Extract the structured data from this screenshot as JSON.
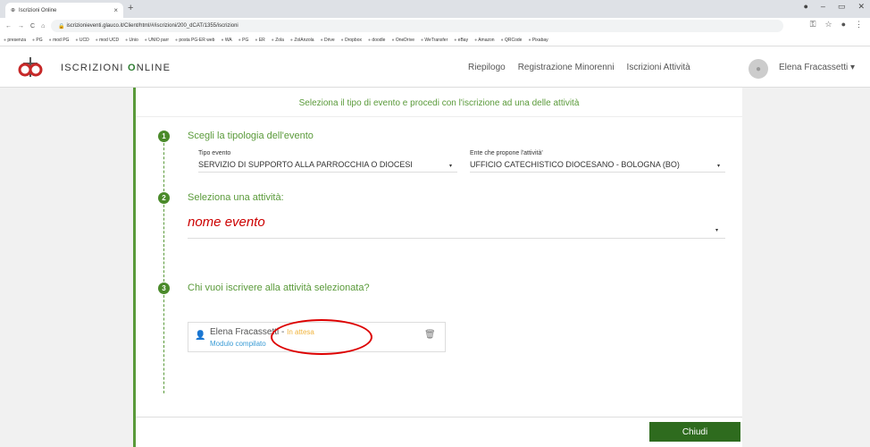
{
  "browser": {
    "tab_title": "Iscrizioni Online",
    "url": "iscrizionieventi.glauco.it/Client/html/#/iscrizioni/200_dCAT/1355/iscrizioni",
    "bookmarks": [
      "presenza",
      "PG",
      "mod PG",
      "UCD",
      "mod UCD",
      "Unio",
      "UNIO parr",
      "posta PG-ER web",
      "WA",
      "PG",
      "ER",
      "Zola",
      "ZolAnzola",
      "Drive",
      "Dropbox",
      "doodle",
      "OneDrive",
      "WeTransfer",
      "eBay",
      "Amazon",
      "QRCode",
      "Pixabay"
    ]
  },
  "header": {
    "brand_prefix": "ISCRIZIONI ",
    "brand_highlight": "O",
    "brand_suffix": "NLINE",
    "nav": [
      "Riepilogo",
      "Registrazione Minorenni",
      "Iscrizioni Attività"
    ],
    "user": "Elena Fracassetti ▾"
  },
  "main": {
    "title": "Seleziona il tipo di evento e procedi con l'iscrizione ad una delle attività",
    "step1": {
      "num": "1",
      "label": "Scegli la tipologia dell'evento",
      "tipo_label": "Tipo evento",
      "tipo_value": "SERVIZIO DI SUPPORTO ALLA PARROCCHIA O DIOCESI",
      "ente_label": "Ente che propone l'attività'",
      "ente_value": "UFFICIO CATECHISTICO DIOCESANO - BOLOGNA (BO)"
    },
    "step2": {
      "num": "2",
      "label": "Seleziona una attività:",
      "value": "nome evento"
    },
    "step3": {
      "num": "3",
      "label": "Chi vuoi iscrivere alla attività selezionata?",
      "person_name": "Elena Fracassetti",
      "person_sep": " - ",
      "person_status": "In attesa",
      "person_module": "Modulo compilato"
    },
    "close_button": "Chiudi"
  }
}
